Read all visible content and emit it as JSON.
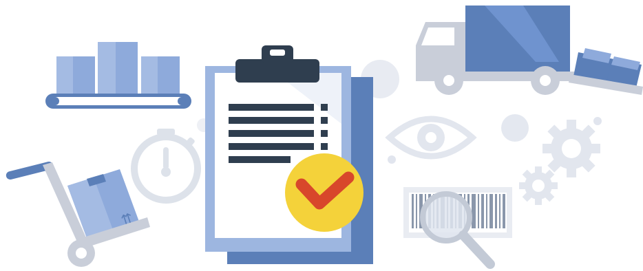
{
  "illustration": {
    "theme": "logistics-inventory-checklist",
    "colors": {
      "background": "#ffffff",
      "blue_dark": "#5b7fb8",
      "blue_mid": "#6f93cf",
      "blue_light": "#9db6e0",
      "gray_light": "#e2e6ee",
      "gray_mid": "#c9ced9",
      "clip_dark": "#2f3e4f",
      "check_yellow": "#f4d23a",
      "check_red": "#d8472b"
    },
    "icons": [
      "conveyor-belt-icon",
      "hand-truck-icon",
      "stopwatch-icon",
      "clipboard-checklist-icon",
      "checkmark-badge-icon",
      "eye-icon",
      "delivery-truck-icon",
      "gears-icon",
      "barcode-magnifier-icon"
    ]
  }
}
